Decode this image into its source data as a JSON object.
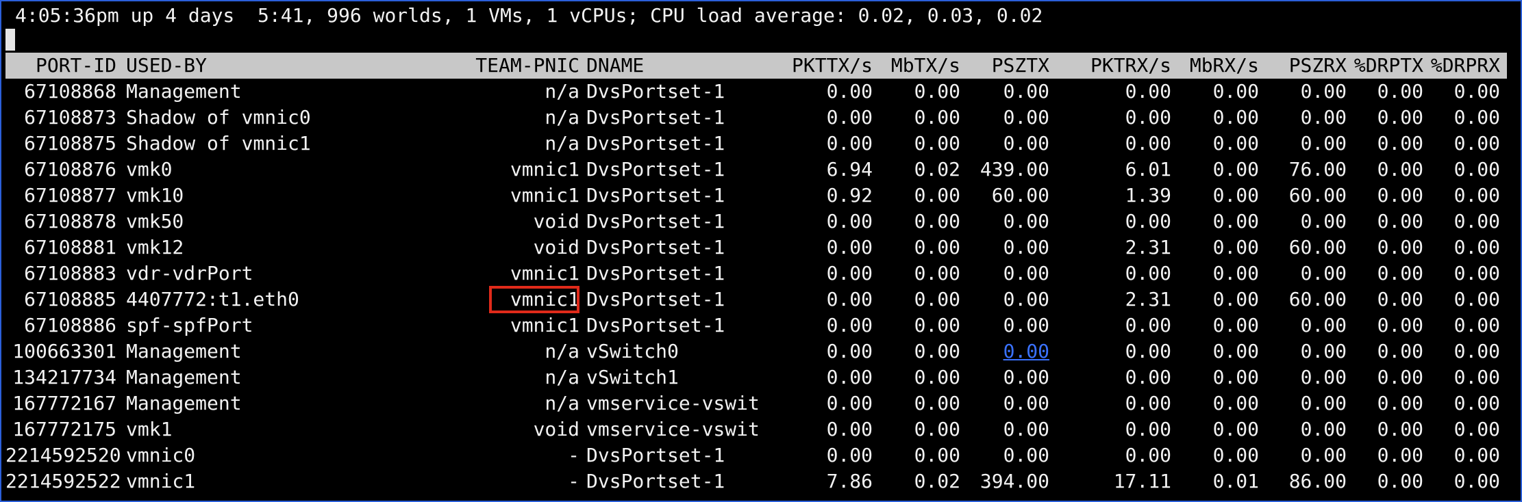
{
  "status_line": "4:05:36pm up 4 days  5:41, 996 worlds, 1 VMs, 1 vCPUs; CPU load average: 0.02, 0.03, 0.02",
  "columns": [
    "PORT-ID",
    "USED-BY",
    "TEAM-PNIC",
    "DNAME",
    "PKTTX/s",
    "MbTX/s",
    "PSZTX",
    "PKTRX/s",
    "MbRX/s",
    "PSZRX",
    "%DRPTX",
    "%DRPRX"
  ],
  "rows": [
    {
      "port_id": "67108868",
      "used_by": "Management",
      "team_pnic": "n/a",
      "dname": "DvsPortset-1",
      "pkttx": "0.00",
      "mbtx": "0.00",
      "psztx": "0.00",
      "pktrx": "0.00",
      "mbrx": "0.00",
      "pszrx": "0.00",
      "drptx": "0.00",
      "drprx": "0.00"
    },
    {
      "port_id": "67108873",
      "used_by": "Shadow of vmnic0",
      "team_pnic": "n/a",
      "dname": "DvsPortset-1",
      "pkttx": "0.00",
      "mbtx": "0.00",
      "psztx": "0.00",
      "pktrx": "0.00",
      "mbrx": "0.00",
      "pszrx": "0.00",
      "drptx": "0.00",
      "drprx": "0.00"
    },
    {
      "port_id": "67108875",
      "used_by": "Shadow of vmnic1",
      "team_pnic": "n/a",
      "dname": "DvsPortset-1",
      "pkttx": "0.00",
      "mbtx": "0.00",
      "psztx": "0.00",
      "pktrx": "0.00",
      "mbrx": "0.00",
      "pszrx": "0.00",
      "drptx": "0.00",
      "drprx": "0.00"
    },
    {
      "port_id": "67108876",
      "used_by": "vmk0",
      "team_pnic": "vmnic1",
      "dname": "DvsPortset-1",
      "pkttx": "6.94",
      "mbtx": "0.02",
      "psztx": "439.00",
      "pktrx": "6.01",
      "mbrx": "0.00",
      "pszrx": "76.00",
      "drptx": "0.00",
      "drprx": "0.00"
    },
    {
      "port_id": "67108877",
      "used_by": "vmk10",
      "team_pnic": "vmnic1",
      "dname": "DvsPortset-1",
      "pkttx": "0.92",
      "mbtx": "0.00",
      "psztx": "60.00",
      "pktrx": "1.39",
      "mbrx": "0.00",
      "pszrx": "60.00",
      "drptx": "0.00",
      "drprx": "0.00"
    },
    {
      "port_id": "67108878",
      "used_by": "vmk50",
      "team_pnic": "void",
      "dname": "DvsPortset-1",
      "pkttx": "0.00",
      "mbtx": "0.00",
      "psztx": "0.00",
      "pktrx": "0.00",
      "mbrx": "0.00",
      "pszrx": "0.00",
      "drptx": "0.00",
      "drprx": "0.00"
    },
    {
      "port_id": "67108881",
      "used_by": "vmk12",
      "team_pnic": "void",
      "dname": "DvsPortset-1",
      "pkttx": "0.00",
      "mbtx": "0.00",
      "psztx": "0.00",
      "pktrx": "2.31",
      "mbrx": "0.00",
      "pszrx": "60.00",
      "drptx": "0.00",
      "drprx": "0.00"
    },
    {
      "port_id": "67108883",
      "used_by": "vdr-vdrPort",
      "team_pnic": "vmnic1",
      "dname": "DvsPortset-1",
      "pkttx": "0.00",
      "mbtx": "0.00",
      "psztx": "0.00",
      "pktrx": "0.00",
      "mbrx": "0.00",
      "pszrx": "0.00",
      "drptx": "0.00",
      "drprx": "0.00"
    },
    {
      "port_id": "67108885",
      "used_by": "4407772:t1.eth0",
      "team_pnic": "vmnic1",
      "dname": "DvsPortset-1",
      "pkttx": "0.00",
      "mbtx": "0.00",
      "psztx": "0.00",
      "pktrx": "2.31",
      "mbrx": "0.00",
      "pszrx": "60.00",
      "drptx": "0.00",
      "drprx": "0.00"
    },
    {
      "port_id": "67108886",
      "used_by": "spf-spfPort",
      "team_pnic": "vmnic1",
      "dname": "DvsPortset-1",
      "pkttx": "0.00",
      "mbtx": "0.00",
      "psztx": "0.00",
      "pktrx": "0.00",
      "mbrx": "0.00",
      "pszrx": "0.00",
      "drptx": "0.00",
      "drprx": "0.00"
    },
    {
      "port_id": "100663301",
      "used_by": "Management",
      "team_pnic": "n/a",
      "dname": "vSwitch0",
      "pkttx": "0.00",
      "mbtx": "0.00",
      "psztx": "0.00",
      "pktrx": "0.00",
      "mbrx": "0.00",
      "pszrx": "0.00",
      "drptx": "0.00",
      "drprx": "0.00"
    },
    {
      "port_id": "134217734",
      "used_by": "Management",
      "team_pnic": "n/a",
      "dname": "vSwitch1",
      "pkttx": "0.00",
      "mbtx": "0.00",
      "psztx": "0.00",
      "pktrx": "0.00",
      "mbrx": "0.00",
      "pszrx": "0.00",
      "drptx": "0.00",
      "drprx": "0.00"
    },
    {
      "port_id": "167772167",
      "used_by": "Management",
      "team_pnic": "n/a",
      "dname": "vmservice-vswit",
      "pkttx": "0.00",
      "mbtx": "0.00",
      "psztx": "0.00",
      "pktrx": "0.00",
      "mbrx": "0.00",
      "pszrx": "0.00",
      "drptx": "0.00",
      "drprx": "0.00"
    },
    {
      "port_id": "167772175",
      "used_by": "vmk1",
      "team_pnic": "void",
      "dname": "vmservice-vswit",
      "pkttx": "0.00",
      "mbtx": "0.00",
      "psztx": "0.00",
      "pktrx": "0.00",
      "mbrx": "0.00",
      "pszrx": "0.00",
      "drptx": "0.00",
      "drprx": "0.00"
    },
    {
      "port_id": "2214592520",
      "used_by": "vmnic0",
      "team_pnic": "-",
      "dname": "DvsPortset-1",
      "pkttx": "0.00",
      "mbtx": "0.00",
      "psztx": "0.00",
      "pktrx": "0.00",
      "mbrx": "0.00",
      "pszrx": "0.00",
      "drptx": "0.00",
      "drprx": "0.00"
    },
    {
      "port_id": "2214592522",
      "used_by": "vmnic1",
      "team_pnic": "-",
      "dname": "DvsPortset-1",
      "pkttx": "7.86",
      "mbtx": "0.02",
      "psztx": "394.00",
      "pktrx": "17.11",
      "mbrx": "0.01",
      "pszrx": "86.00",
      "drptx": "0.00",
      "drprx": "0.00"
    }
  ],
  "colors": {
    "background": "#000000",
    "text": "#f2f2f2",
    "header_bg": "#c8c8c8",
    "highlight_box": "#e02a1a",
    "link": "#3a72ff",
    "window_border": "#2b5fd9"
  }
}
